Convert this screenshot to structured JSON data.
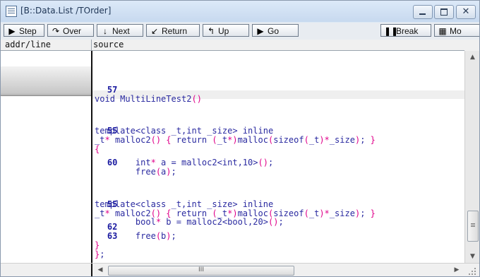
{
  "window": {
    "title": "[B::Data.List /TOrder]"
  },
  "toolbar": {
    "buttons": [
      {
        "label": "Step",
        "icon": "step-icon"
      },
      {
        "label": "Over",
        "icon": "step-over-icon"
      },
      {
        "label": "Next",
        "icon": "next-arrow-icon"
      },
      {
        "label": "Return",
        "icon": "return-arrow-icon"
      },
      {
        "label": "Up",
        "icon": "up-arrow-icon"
      },
      {
        "label": "Go",
        "icon": "go-triangle-icon"
      },
      {
        "label": "Break",
        "icon": "pause-icon"
      },
      {
        "label": "Mo",
        "icon": "mode-icon"
      }
    ]
  },
  "columns": {
    "addr_line": "addr/line",
    "source": "source"
  },
  "listing": [
    {
      "line": "57",
      "code": "void MultiLineTest2()"
    },
    {
      "line": "",
      "code": "template<class _t,int _size> inline"
    },
    {
      "line": "55",
      "code": "_t* malloc2() { return (_t*)malloc(sizeof(_t)*_size); }"
    },
    {
      "line": "",
      "code": "{"
    },
    {
      "line": "",
      "code": "        int* a = malloc2<int,10>();"
    },
    {
      "line": "60",
      "code": "        free(a);"
    },
    {
      "line": "",
      "code": "template<class _t,int _size> inline"
    },
    {
      "line": "55",
      "code": "_t* malloc2() { return (_t*)malloc(sizeof(_t)*_size); }"
    },
    {
      "line": "",
      "code": "        bool* b = malloc2<bool,20>();"
    },
    {
      "line": "62",
      "code": "        free(b);"
    },
    {
      "line": "63",
      "code": "}"
    },
    {
      "line": "",
      "code": "};"
    }
  ],
  "scrollbar": {
    "horizontal_thumb_glyph": "III"
  }
}
